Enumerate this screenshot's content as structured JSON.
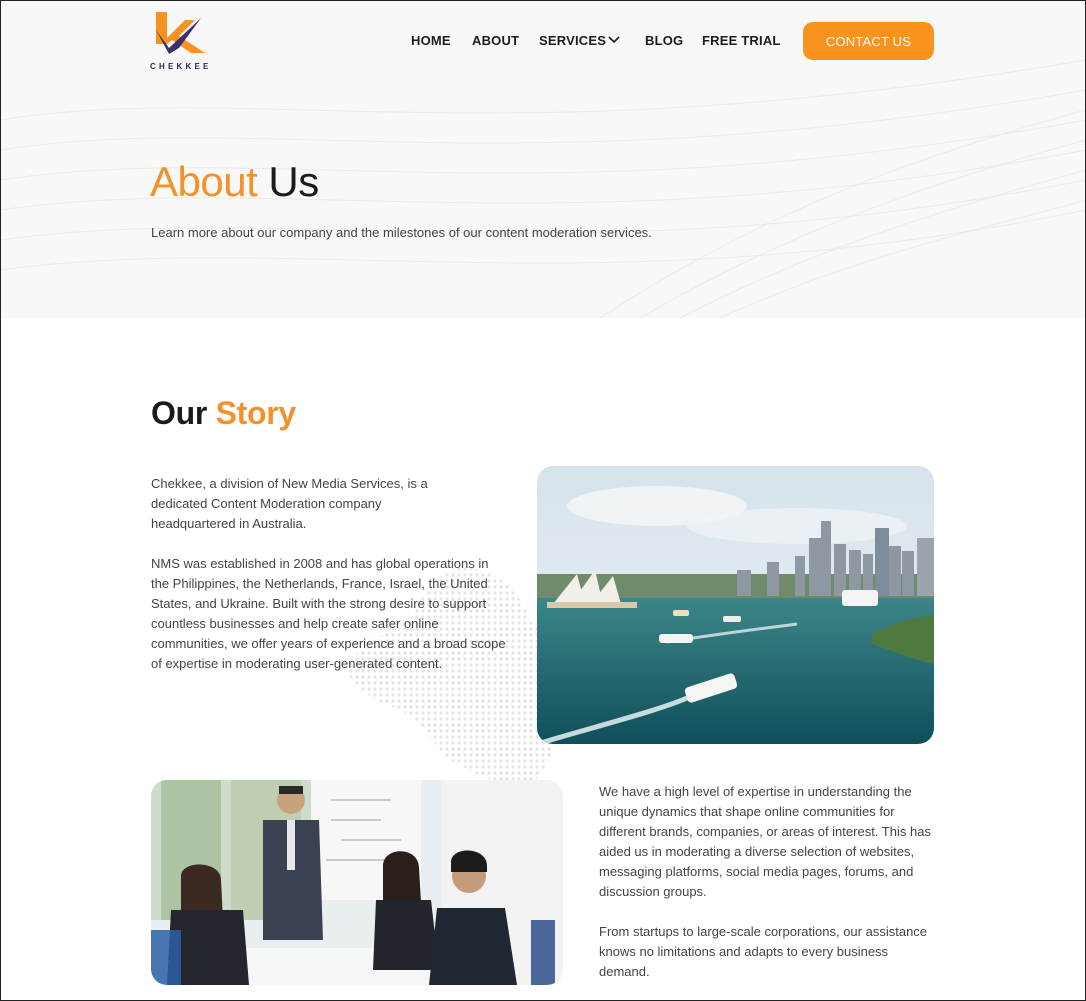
{
  "header": {
    "logo_text": "CHEKKEE",
    "nav": [
      "HOME",
      "ABOUT",
      "SERVICES",
      "BLOG",
      "FREE TRIAL"
    ],
    "cta": "CONTACT US"
  },
  "hero": {
    "title_accent": "About",
    "title_rest": " Us",
    "subtitle": "Learn more about our company and the milestones of our content moderation services."
  },
  "story": {
    "title_lead": "Our ",
    "title_accent": "Story",
    "paragraphs": [
      "Chekkee, a division of New Media Services, is a dedicated Content Moderation company headquartered in Australia.",
      "NMS was established in 2008 and has global operations in the Philippines, the Netherlands, France, Israel, the United States, and Ukraine. Built with the strong desire to support countless businesses and help create safer online communities, we offer years of experience and a broad scope of expertise in moderating user-generated content.",
      "We have a high level of expertise in understanding the unique dynamics that shape online communities for different brands, companies, or areas of interest. This has aided us in moderating a diverse selection of websites, messaging platforms, social media pages, forums, and discussion groups.",
      "From startups to large-scale corporations, our assistance knows no limitations and adapts to every business demand."
    ]
  },
  "colors": {
    "accent": "#f7931e",
    "text": "#1c1c1c",
    "hero_bg": "#f8f8f8"
  },
  "icons": {
    "services_chevron": "chevron-down-icon"
  }
}
